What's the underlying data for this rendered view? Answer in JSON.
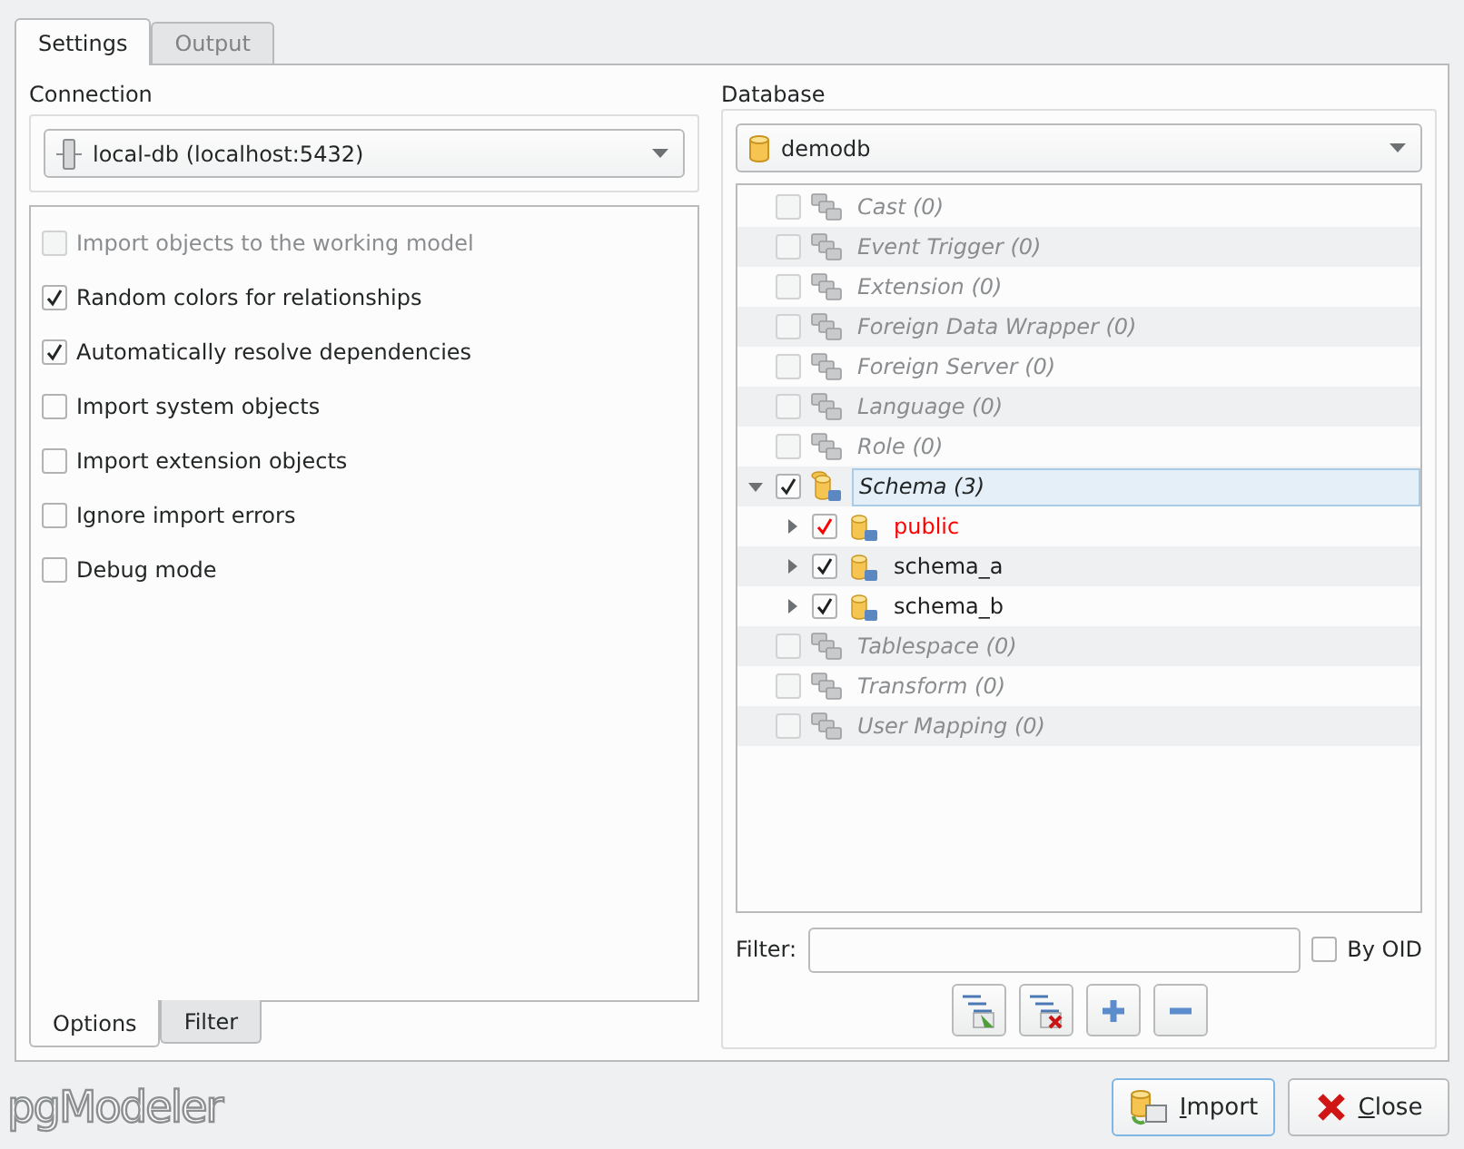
{
  "tabs": [
    {
      "label": "Settings",
      "selected": true
    },
    {
      "label": "Output",
      "selected": false
    }
  ],
  "connection": {
    "label": "Connection",
    "value": "local-db (localhost:5432)"
  },
  "options": [
    {
      "label": "Import objects to the working model",
      "checked": false,
      "disabled": true
    },
    {
      "label": "Random colors for relationships",
      "checked": true,
      "disabled": false
    },
    {
      "label": "Automatically resolve dependencies",
      "checked": true,
      "disabled": false
    },
    {
      "label": "Import system objects",
      "checked": false,
      "disabled": false
    },
    {
      "label": "Import extension objects",
      "checked": false,
      "disabled": false
    },
    {
      "label": "Ignore import errors",
      "checked": false,
      "disabled": false
    },
    {
      "label": "Debug mode",
      "checked": false,
      "disabled": false
    }
  ],
  "bottom_tabs": [
    {
      "label": "Options",
      "selected": true
    },
    {
      "label": "Filter",
      "selected": false
    }
  ],
  "database": {
    "label": "Database",
    "value": "demodb"
  },
  "tree": [
    {
      "label": "Cast (0)",
      "checked": false,
      "disabled": true,
      "selected": false
    },
    {
      "label": "Event Trigger (0)",
      "checked": false,
      "disabled": true,
      "selected": false
    },
    {
      "label": "Extension (0)",
      "checked": false,
      "disabled": true,
      "selected": false
    },
    {
      "label": "Foreign Data Wrapper (0)",
      "checked": false,
      "disabled": true,
      "selected": false
    },
    {
      "label": "Foreign Server (0)",
      "checked": false,
      "disabled": true,
      "selected": false
    },
    {
      "label": "Language (0)",
      "checked": false,
      "disabled": true,
      "selected": false
    },
    {
      "label": "Role (0)",
      "checked": false,
      "disabled": true,
      "selected": false
    },
    {
      "label": "Schema (3)",
      "checked": true,
      "disabled": false,
      "selected": true,
      "expanded": true,
      "children": [
        {
          "label": "public",
          "checked": true,
          "selected": false,
          "color": "#ff0000",
          "expanded": false
        },
        {
          "label": "schema_a",
          "checked": true,
          "selected": false,
          "color": "#1e1e1e",
          "expanded": false
        },
        {
          "label": "schema_b",
          "checked": true,
          "selected": false,
          "color": "#1e1e1e",
          "expanded": false
        }
      ]
    },
    {
      "label": "Tablespace (0)",
      "checked": false,
      "disabled": true,
      "selected": false
    },
    {
      "label": "Transform (0)",
      "checked": false,
      "disabled": true,
      "selected": false
    },
    {
      "label": "User Mapping (0)",
      "checked": false,
      "disabled": true,
      "selected": false
    }
  ],
  "filter": {
    "label": "Filter:",
    "by_oid": {
      "label": "By OID",
      "checked": false
    }
  },
  "logo": "pgModeler",
  "buttons": [
    {
      "label": "Import",
      "kind": "import",
      "default": true
    },
    {
      "label": "Close",
      "kind": "close",
      "default": false
    }
  ]
}
